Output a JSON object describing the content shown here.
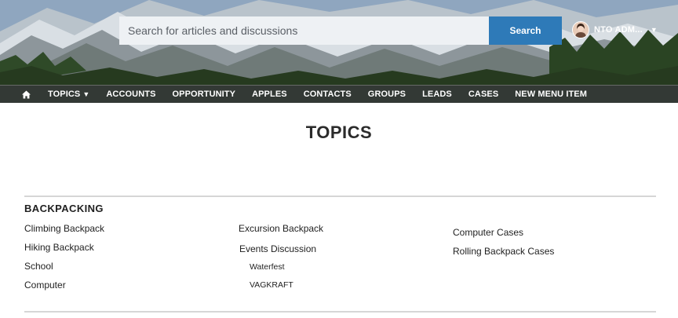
{
  "header": {
    "search": {
      "placeholder": "Search for articles and discussions",
      "button_label": "Search"
    },
    "user": {
      "name": "NTO ADM..."
    }
  },
  "nav": {
    "items": [
      {
        "label": "TOPICS",
        "has_dropdown": true
      },
      {
        "label": "ACCOUNTS"
      },
      {
        "label": "OPPORTUNITY"
      },
      {
        "label": "APPLES"
      },
      {
        "label": "CONTACTS"
      },
      {
        "label": "GROUPS"
      },
      {
        "label": "LEADS"
      },
      {
        "label": "CASES"
      },
      {
        "label": "NEW MENU ITEM"
      }
    ]
  },
  "main": {
    "title": "TOPICS",
    "section": {
      "title": "BACKPACKING",
      "columns": [
        [
          "Climbing Backpack",
          "Hiking Backpack",
          "School",
          "Computer"
        ],
        [
          "Excursion Backpack",
          "Events Discussion",
          "Waterfest",
          "VAGKRAFT"
        ],
        [
          "Computer Cases",
          "Rolling Backpack Cases"
        ]
      ]
    }
  }
}
